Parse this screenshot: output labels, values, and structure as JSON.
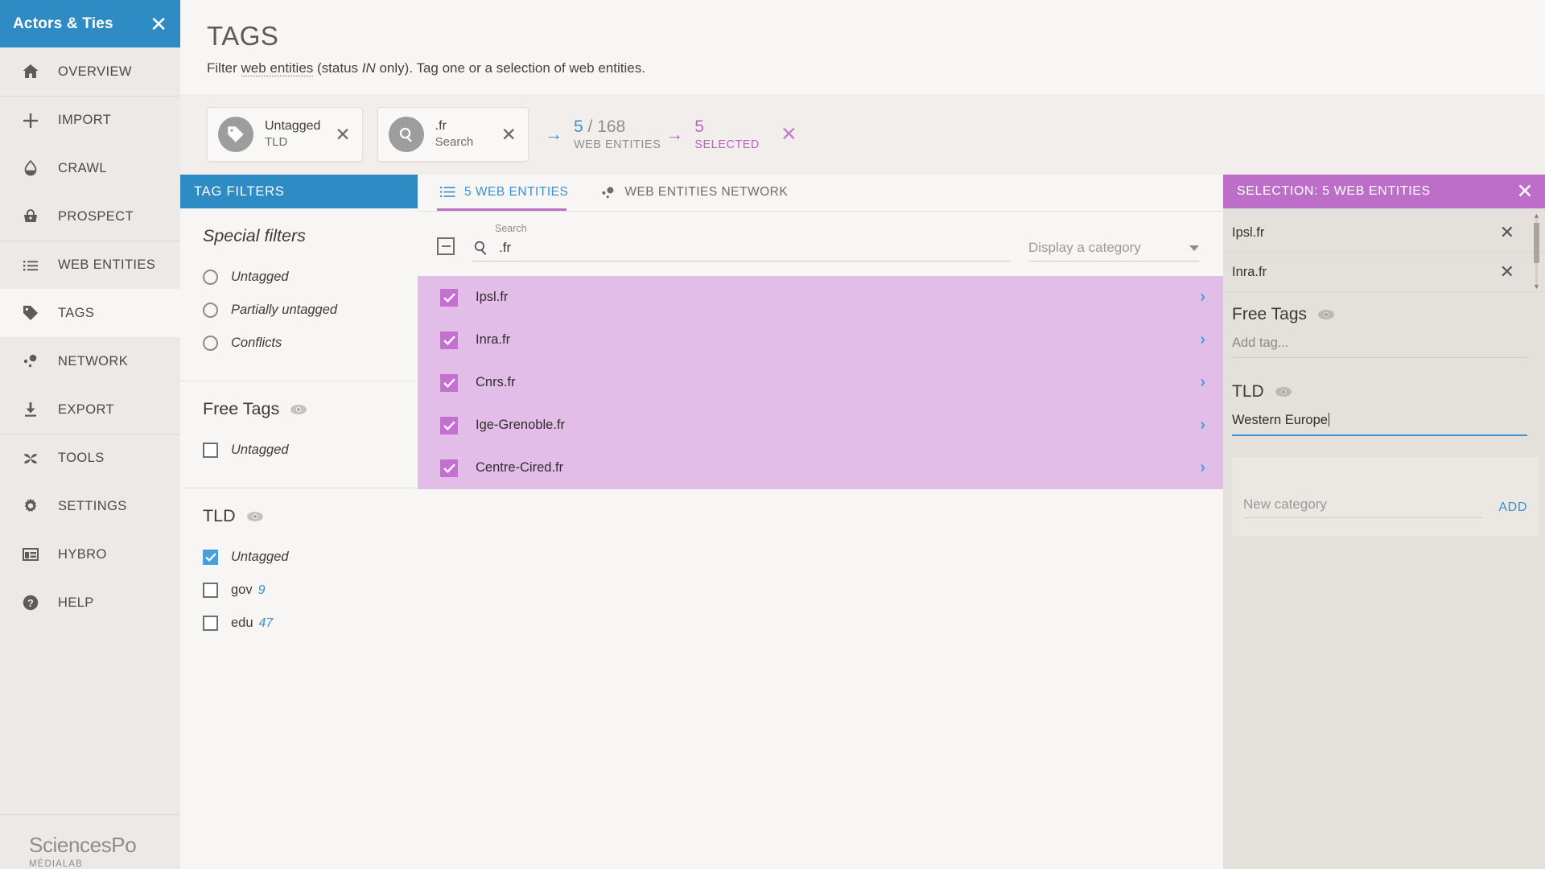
{
  "sidebar": {
    "header_title": "Actors & Ties",
    "close_icon": "✕",
    "items": [
      {
        "label": "OVERVIEW",
        "icon": "home-icon"
      },
      {
        "label": "IMPORT",
        "icon": "plus-icon"
      },
      {
        "label": "CRAWL",
        "icon": "droplet-icon"
      },
      {
        "label": "PROSPECT",
        "icon": "basket-icon"
      },
      {
        "label": "WEB ENTITIES",
        "icon": "list-icon"
      },
      {
        "label": "TAGS",
        "icon": "tag-icon"
      },
      {
        "label": "NETWORK",
        "icon": "network-icon"
      },
      {
        "label": "EXPORT",
        "icon": "download-icon"
      },
      {
        "label": "TOOLS",
        "icon": "pinwheel-icon"
      },
      {
        "label": "SETTINGS",
        "icon": "gear-icon"
      },
      {
        "label": "HYBRO",
        "icon": "layout-icon"
      },
      {
        "label": "HELP",
        "icon": "question-icon"
      }
    ],
    "logo": {
      "name": "SciencesPo",
      "sub": "MÉDIALAB"
    }
  },
  "page": {
    "title": "TAGS",
    "subtitle_parts": {
      "a": "Filter ",
      "link": "web entities",
      "b": " (status ",
      "ital": "IN",
      "c": " only). Tag one or a selection of web entities."
    }
  },
  "filters_bar": {
    "chips": [
      {
        "main": "Untagged",
        "sub": "TLD",
        "icon": "tag-icon",
        "close": "✕"
      },
      {
        "main": ".fr",
        "sub": "Search",
        "icon": "search-icon",
        "close": "✕"
      }
    ],
    "stats": {
      "count": "5",
      "separator": "/",
      "total": "168",
      "entities_label": "WEB ENTITIES",
      "selected_count": "5",
      "selected_label": "SELECTED",
      "clear_selection_icon": "✕"
    },
    "arrow": "→"
  },
  "tag_filters": {
    "header": "TAG FILTERS",
    "special": {
      "title": "Special filters",
      "options": [
        {
          "label": "Untagged",
          "checked": false
        },
        {
          "label": "Partially untagged",
          "checked": false
        },
        {
          "label": "Conflicts",
          "checked": false
        }
      ]
    },
    "free_tags": {
      "title": "Free Tags",
      "eye_icon": "eye-icon",
      "options": [
        {
          "label": "Untagged",
          "checked": false,
          "count": ""
        }
      ]
    },
    "tld": {
      "title": "TLD",
      "eye_icon": "eye-icon",
      "options": [
        {
          "label": "Untagged",
          "checked": true,
          "count": ""
        },
        {
          "label": "gov",
          "checked": false,
          "count": "9"
        },
        {
          "label": "edu",
          "checked": false,
          "count": "47"
        }
      ]
    }
  },
  "center": {
    "tabs": [
      {
        "label": "5 WEB ENTITIES",
        "icon": "list-icon",
        "active": true
      },
      {
        "label": "WEB ENTITIES NETWORK",
        "icon": "network-icon",
        "active": false
      }
    ],
    "search": {
      "label": "Search",
      "value": ".fr",
      "icon": "search-icon",
      "select_all_icon": "minus-box-icon"
    },
    "category_select": {
      "placeholder": "Display a category",
      "caret": "▾"
    },
    "entities": [
      {
        "name": "Ipsl.fr",
        "checked": true
      },
      {
        "name": "Inra.fr",
        "checked": true
      },
      {
        "name": "Cnrs.fr",
        "checked": true
      },
      {
        "name": "Ige-Grenoble.fr",
        "checked": true
      },
      {
        "name": "Centre-Cired.fr",
        "checked": true
      }
    ],
    "chevron": "›",
    "check": "✓"
  },
  "selection": {
    "header": "SELECTION: 5 WEB ENTITIES",
    "close_icon": "✕",
    "items": [
      {
        "name": "Ipsl.fr",
        "remove": "✕"
      },
      {
        "name": "Inra.fr",
        "remove": "✕"
      }
    ],
    "free_tags": {
      "title": "Free Tags",
      "eye_icon": "eye-icon",
      "input_placeholder": "Add tag..."
    },
    "tld": {
      "title": "TLD",
      "eye_icon": "eye-icon",
      "input_value": "Western Europe"
    },
    "new_category": {
      "placeholder": "New category",
      "add_label": "ADD"
    }
  },
  "colors": {
    "blue": "#2e8bc4",
    "purple": "#bd6ec9",
    "row_purple": "#e2bde8",
    "sidebar_bg": "#ece9e6"
  }
}
